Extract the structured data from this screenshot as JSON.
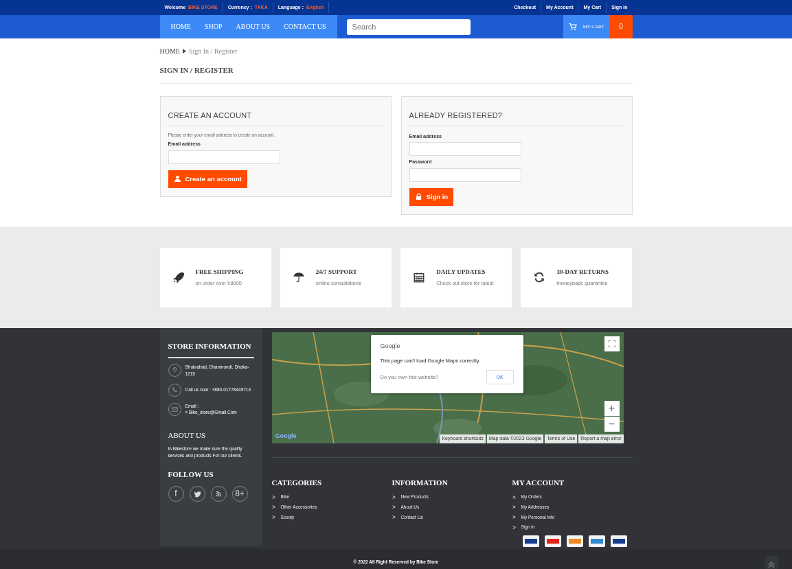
{
  "top_bar": {
    "welcome": {
      "label": "Welcome",
      "value": "BIKE STORE"
    },
    "currency": {
      "label": "Currency :",
      "value": "TAKA"
    },
    "language": {
      "label": "Language :",
      "value": "English"
    },
    "links": [
      "Checkout",
      "My Account",
      "My Cart",
      "Sign In"
    ]
  },
  "nav": {
    "items": [
      "HOME",
      "SHOP",
      "ABOUT US",
      "CONTACT US"
    ],
    "search": {
      "placeholder": "Search"
    },
    "cart": {
      "label": "MY CART",
      "count": "0"
    }
  },
  "breadcrumb": {
    "home": "HOME",
    "current": "Sign In / Register"
  },
  "page_title": "SIGN IN / REGISTER",
  "create_account": {
    "title": "CREATE AN ACCOUNT",
    "intro": "Please enter your email address to create an account.",
    "fields": [
      {
        "label": "Email address"
      }
    ],
    "button": {
      "kind": "user",
      "label": "Create an account"
    }
  },
  "login": {
    "title": "ALREADY REGISTERED?",
    "fields": [
      {
        "label": "Email address"
      },
      {
        "label": "Password"
      }
    ],
    "button": {
      "kind": "lock",
      "label": "Sign in"
    }
  },
  "features": [
    {
      "kind": "rocket",
      "title": "FREE SHIPPING",
      "text": "on order over ৳8000"
    },
    {
      "kind": "umbrella",
      "title": "24/7 SUPPORT",
      "text": "online consultations"
    },
    {
      "kind": "calendar",
      "title": "DAILY UPDATES",
      "text": "Check out store for latest"
    },
    {
      "kind": "refresh",
      "title": "30-DAY RETURNS",
      "text": "moneyback guarantee"
    }
  ],
  "store_info": {
    "title": "STORE INFORMATION",
    "items": [
      {
        "kind": "pin",
        "lines": [
          "Shukrabad, Dhanmondi, Dhaka-1215"
        ]
      },
      {
        "kind": "phone",
        "lines": [
          "Call us now : +880-01778449714"
        ]
      },
      {
        "kind": "mail",
        "lines": [
          "Email :",
          "» Bike_store@Gmail.Com"
        ]
      }
    ]
  },
  "about": {
    "title": "ABOUT US",
    "text": "In Bikestore we make sure the quality services and products For our clients."
  },
  "follow": {
    "title": "FOLLOW US",
    "links": [
      {
        "kind": "glyph",
        "glyph": "f"
      },
      {
        "kind": "twitter"
      },
      {
        "kind": "rss"
      },
      {
        "kind": "glyph",
        "glyph": "8+"
      }
    ]
  },
  "map": {
    "logo": "Google",
    "dialog": {
      "brand": "Google",
      "message": "This page can't load Google Maps correctly.",
      "question": "Do you own this website?",
      "button": "OK"
    },
    "zoom": [
      "+",
      "−"
    ],
    "attribution": [
      "Keyboard shortcuts",
      "Map data ©2023 Google",
      "Terms of Use",
      "Report a map error"
    ]
  },
  "link_columns": [
    {
      "title": "CATEGORIES",
      "links": [
        "Bike",
        "Other Accessories",
        "Scooty"
      ]
    },
    {
      "title": "INFORMATION",
      "links": [
        "New Products",
        "About Us",
        "Contact Us"
      ]
    },
    {
      "title": "MY ACCOUNT",
      "links": [
        "My Orders",
        "My Addresses",
        "My Personal Info",
        "Sign In"
      ]
    }
  ],
  "payment_cards": [
    {
      "color": "#1a3f8f"
    },
    {
      "color": "#e8251d"
    },
    {
      "color": "#f08a1d"
    },
    {
      "color": "#2f8ad2"
    },
    {
      "color": "#163d8c"
    }
  ],
  "copyright": "© 2022 All Right Reserved by Bike Store"
}
